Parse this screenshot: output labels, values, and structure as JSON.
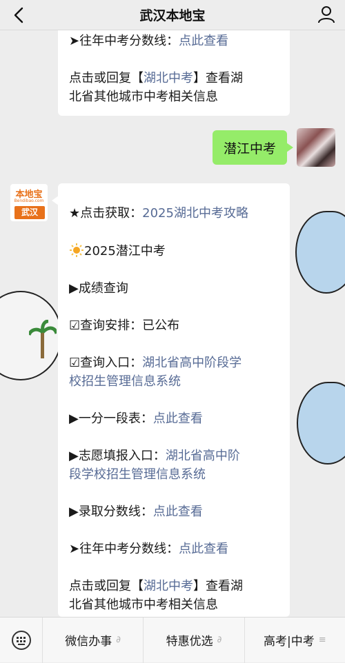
{
  "header": {
    "title": "武汉本地宝"
  },
  "top_message": {
    "line1_prefix": "➤往年中考分数线：",
    "line1_link": "点此查看",
    "line2_a": "点击或回复【",
    "line2_link": "湖北中考",
    "line2_b": "】查看湖",
    "line3": "北省其他城市中考相关信息"
  },
  "sent_message": {
    "text": "潜江中考"
  },
  "bot_avatar": {
    "top": "本地宝",
    "mid": "Bendibao.com",
    "bottom": "武汉"
  },
  "reply": {
    "promo_prefix": "★点击获取：",
    "promo_link": "2025湖北中考攻略",
    "headline_icon": "sun-icon",
    "headline": "2025潜江中考",
    "score_query": "▶成绩查询",
    "query_schedule_label": "☑查询安排：",
    "query_schedule_value": "已公布",
    "query_entry_label": "☑查询入口：",
    "query_entry_link_a": "湖北省高中阶段学",
    "query_entry_link_b": "校招生管理信息系统",
    "rank_prefix": "▶一分一段表：",
    "rank_link": "点此查看",
    "apply_prefix": "▶志愿填报入口：",
    "apply_link_a": "湖北省高中阶",
    "apply_link_b": "段学校招生管理信息系统",
    "admission_prefix": "▶录取分数线：",
    "admission_link": "点此查看",
    "past_prefix": "➤往年中考分数线：",
    "past_link": "点此查看",
    "more_a": "点击或回复【",
    "more_link": "湖北中考",
    "more_b": "】查看湖",
    "more_line2": "北省其他城市中考相关信息"
  },
  "bottom_menu": {
    "items": [
      {
        "label": "微信办事",
        "suffix": "∂"
      },
      {
        "label": "特惠优选",
        "suffix": "∂"
      },
      {
        "label": "高考|中考",
        "suffix": "≡"
      }
    ]
  }
}
